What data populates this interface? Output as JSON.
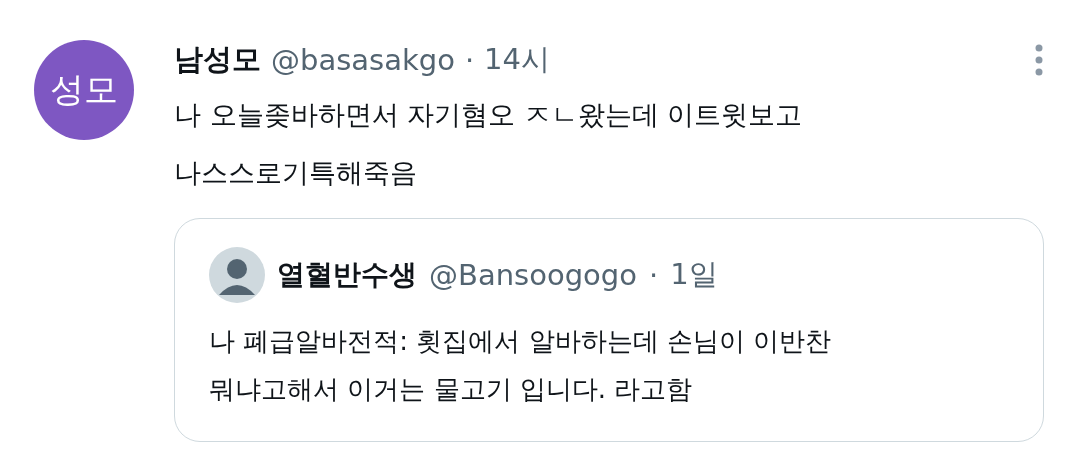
{
  "tweet": {
    "avatar_text": "성모",
    "name": "남성모",
    "handle": "@basasakgo",
    "separator": "·",
    "time": "14시",
    "text": "나 오늘좆바하면서 자기혐오 ㅈㄴ왔는데 이트윗보고\n나스스로기특해죽음",
    "quote": {
      "name": "열혈반수생",
      "handle": "@Bansoogogo",
      "separator": "·",
      "time": "1일",
      "text": "나 폐급알바전적: 횟집에서 알바하는데 손님이 이반찬\n뭐냐고해서 이거는 물고기 입니다. 라고함"
    }
  }
}
